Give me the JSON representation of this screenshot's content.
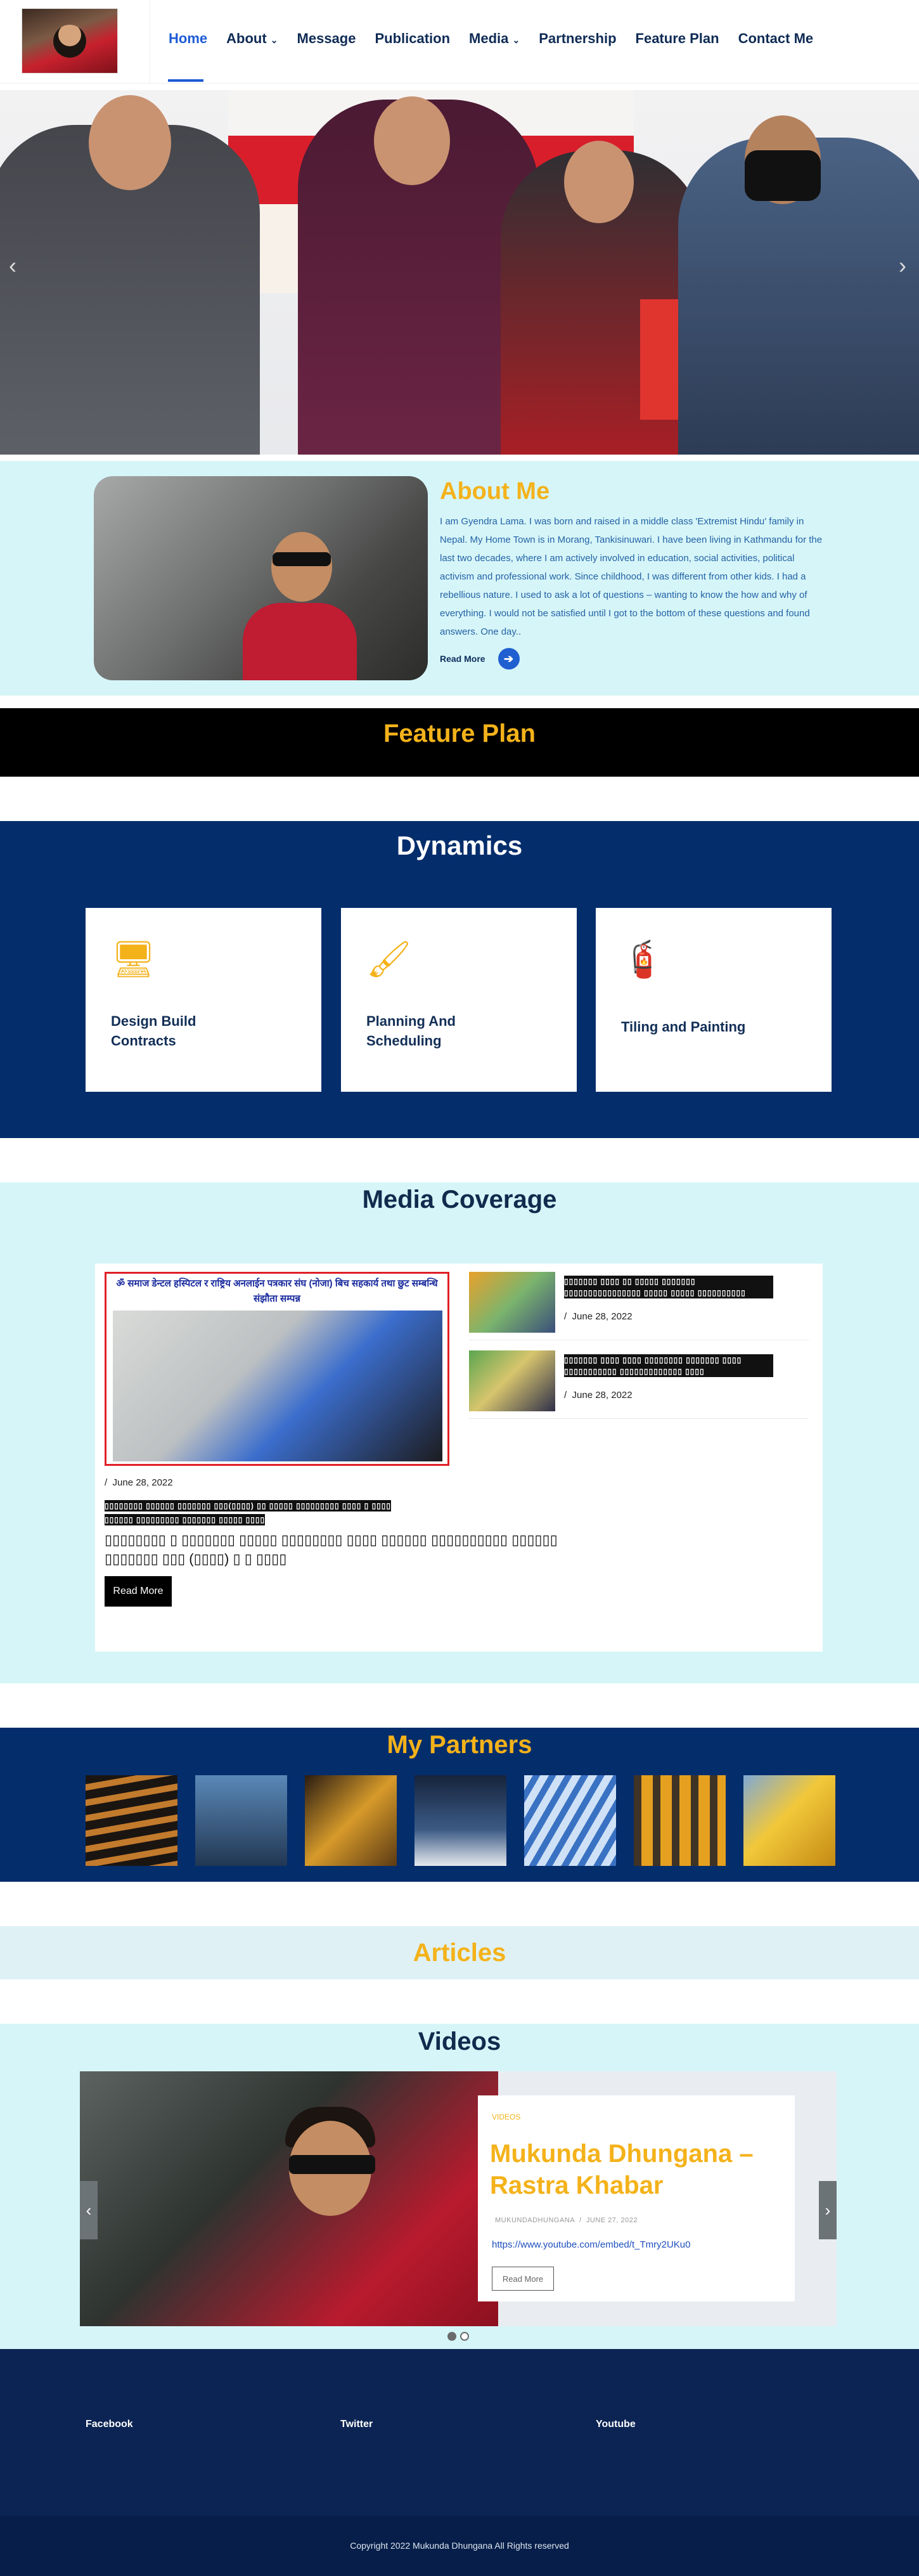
{
  "nav": {
    "items": [
      "Home",
      "About",
      "Message",
      "Publication",
      "Media",
      "Partnership",
      "Feature Plan",
      "Contact Me"
    ],
    "dropdown_mark": "⌄",
    "active_index": 0
  },
  "hero": {
    "prev": "‹",
    "next": "›"
  },
  "about": {
    "title": "About Me",
    "text": "I am Gyendra Lama. I was born and raised in a middle class 'Extremist Hindu' family in Nepal. My Home Town is in Morang, Tankisinuwari. I have been living in Kathmandu for the last two decades, where I am actively involved in education, social activities, political activism and professional work. Since childhood, I was different from other kids. I had a rebellious nature. I used to ask a lot of questions – wanting to know the how and why of everything. I would not be satisfied until I got to the bottom of these questions and found answers. One day..",
    "read_more": "Read More"
  },
  "feature_plan": {
    "title": "Feature Plan"
  },
  "dynamics": {
    "title": "Dynamics",
    "cards": [
      {
        "label": "Design Build Contracts",
        "icon": "monitor-icon"
      },
      {
        "label": "Planning And Scheduling",
        "icon": "brush-icon"
      },
      {
        "label": "Tiling and Painting",
        "icon": "paint-roller-icon"
      }
    ]
  },
  "media": {
    "title": "Media Coverage",
    "main": {
      "header": "ॐ समाज डेन्टल हस्पिटल र राष्ट्रिय अनलाईन पत्रकार संघ (नोजा) बिच सहकार्य तथा छुट सम्बन्धि संझौता सम्पन्न",
      "date": "June 28, 2022",
      "title_line1": "▯▯▯▯▯▯▯▯ ▯▯▯▯▯▯ ▯▯▯▯▯▯▯ ▯▯▯(▯▯▯▯) ▯▯ ▯▯▯▯▯ ▯▯▯▯▯▯▯▯▯ ▯▯▯▯ ▯ ▯▯▯▯",
      "title_line2": "▯▯▯▯▯▯ ▯▯▯▯▯▯▯▯▯ ▯▯▯▯▯▯▯ ▯▯▯▯▯ ▯▯▯▯",
      "excerpt_line1": "▯▯▯▯▯▯▯▯ ▯ ▯▯▯▯▯▯▯ ▯▯▯▯▯ ▯▯▯▯▯▯▯▯ ▯▯▯▯ ▯▯▯▯▯▯ ▯▯▯▯▯▯▯▯▯▯ ▯▯▯▯▯▯",
      "excerpt_line2": "▯▯▯▯▯▯▯ ▯▯▯ (▯▯▯▯) ▯ ▯ ▯▯▯▯",
      "button": "Read More"
    },
    "side": [
      {
        "title": "▯▯▯▯▯▯▯ ▯▯▯▯ ▯▯ ▯▯▯▯▯ ▯▯▯▯▯▯▯ ▯▯▯▯▯▯▯▯▯▯▯▯▯▯▯▯ ▯▯▯▯▯ ▯▯▯▯▯ ▯▯▯▯▯▯▯▯▯▯",
        "date": "June 28, 2022"
      },
      {
        "title": "▯▯▯▯▯▯▯ ▯▯▯▯ ▯▯▯▯ ▯▯▯▯▯▯▯▯ ▯▯▯▯▯▯▯ ▯▯▯▯ ▯▯▯▯▯▯▯▯▯▯▯ ▯▯▯▯▯▯▯▯▯▯▯▯▯ ▯▯▯▯",
        "date": "June 28, 2022"
      }
    ],
    "date_separator": "/"
  },
  "partners": {
    "title": "My Partners",
    "count": 7
  },
  "articles": {
    "title": "Articles"
  },
  "videos": {
    "title": "Videos",
    "tag": "VIDEOS",
    "video_title": "Mukunda Dhungana – Rastra Khabar",
    "author": "MUKUNDADHUNGANA",
    "date": "JUNE 27, 2022",
    "link": "https://www.youtube.com/embed/t_Tmry2UKu0",
    "button": "Read More",
    "prev": "‹",
    "next": "›"
  },
  "footer": {
    "columns": [
      "Facebook",
      "Twitter",
      "Youtube"
    ],
    "copyright": "Copyright 2022 Mukunda Dhungana All Rights reserved"
  },
  "colors": {
    "navy": "#042d6c",
    "gold": "#f4b21a",
    "light_cyan": "#d6f5f8",
    "link_blue": "#1d5bd4"
  }
}
